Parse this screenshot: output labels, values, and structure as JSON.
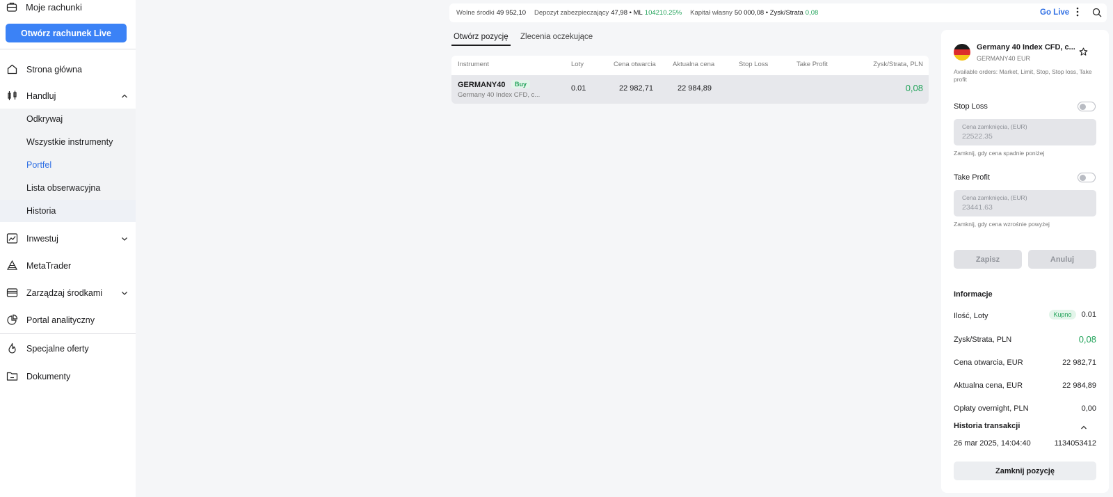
{
  "sidebar": {
    "top_item": "Moje rachunki",
    "live_button": "Otwórz rachunek Live",
    "items": [
      {
        "label": "Strona główna"
      },
      {
        "label": "Handluj"
      },
      {
        "label": "Inwestuj"
      },
      {
        "label": "MetaTrader"
      },
      {
        "label": "Zarządzaj środkami"
      },
      {
        "label": "Portal analityczny"
      },
      {
        "label": "Specjalne oferty"
      },
      {
        "label": "Dokumenty"
      }
    ],
    "sub_items": [
      {
        "label": "Odkrywaj"
      },
      {
        "label": "Wszystkie instrumenty"
      },
      {
        "label": "Portfel"
      },
      {
        "label": "Lista obserwacyjna"
      },
      {
        "label": "Historia"
      }
    ]
  },
  "topbar": {
    "free_funds_label": "Wolne środki",
    "free_funds_value": "49 952,10",
    "margin_label": "Depozyt zabezpieczający",
    "margin_value": "47,98 • ML",
    "ml_value": "104210.25%",
    "equity_label": "Kapitał własny",
    "equity_value": "50 000,08 • Zysk/Strata",
    "pl_value": "0,08",
    "go_live": "Go Live"
  },
  "tabs": [
    {
      "label": "Otwórz pozycję"
    },
    {
      "label": "Zlecenia oczekujące"
    }
  ],
  "table": {
    "headers": [
      "Instrument",
      "Loty",
      "Cena otwarcia",
      "Aktualna cena",
      "Stop Loss",
      "Take Profit",
      "Zysk/Strata, PLN"
    ],
    "row": {
      "symbol": "GERMANY40",
      "side": "Buy",
      "desc": "Germany 40 Index CFD, c...",
      "lots": "0.01",
      "open_price": "22 982,71",
      "current_price": "22 984,89",
      "pl": "0,08"
    }
  },
  "panel": {
    "title": "Germany 40 Index CFD, c...",
    "subtitle": "GERMANY40 EUR",
    "orders": "Available orders: Market, Limit, Stop, Stop loss, Take profit",
    "stop_loss_label": "Stop Loss",
    "sl_field_label": "Cena zamknięcia, (EUR)",
    "sl_value": "22522.35",
    "sl_hint": "Zamknij, gdy cena spadnie poniżej",
    "take_profit_label": "Take Profit",
    "tp_field_label": "Cena zamknięcia, (EUR)",
    "tp_value": "23441.63",
    "tp_hint": "Zamknij, gdy cena wzrośnie powyżej",
    "save_button": "Zapisz",
    "cancel_button": "Anuluj",
    "info_header": "Informacje",
    "info": {
      "lots_label": "Ilość, Loty",
      "lots_side": "Kupno",
      "lots_value": "0.01",
      "pl_label": "Zysk/Strata, PLN",
      "pl_value": "0,08",
      "open_label": "Cena otwarcia, EUR",
      "open_value": "22 982,71",
      "current_label": "Aktualna cena, EUR",
      "current_value": "22 984,89",
      "overnight_label": "Opłaty overnight, PLN",
      "overnight_value": "0,00"
    },
    "history_header": "Historia transakcji",
    "history_date": "26 mar 2025, 14:04:40",
    "history_id": "1134053412",
    "close_button": "Zamknij pozycję"
  },
  "colors": {
    "accent": "#3b82f6",
    "link": "#2f6fe4",
    "profit": "#22a35a"
  }
}
